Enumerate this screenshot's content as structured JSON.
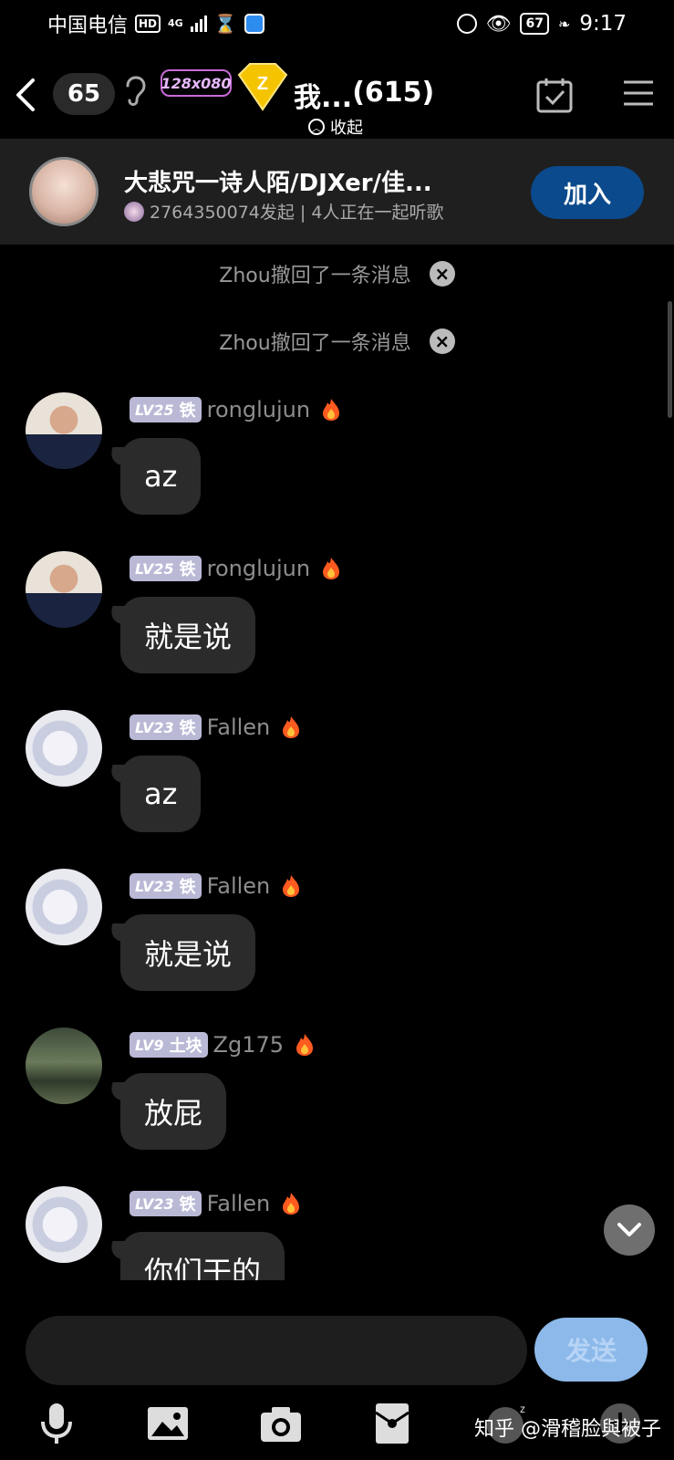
{
  "status_bar": {
    "carrier": "中国电信",
    "hd": "HD",
    "net": "4G",
    "battery": "67",
    "time": "9:17"
  },
  "header": {
    "member_count": "65",
    "club_badge": "128x080",
    "title": "我...",
    "title_count": "(615)",
    "collapse_label": "收起"
  },
  "listen_banner": {
    "title": "大悲咒一诗人陌/DJXer/佳...",
    "subtitle": "2764350074发起 | 4人正在一起听歌",
    "join_label": "加入"
  },
  "recalls": [
    {
      "text": "Zhou撤回了一条消息"
    },
    {
      "text": "Zhou撤回了一条消息"
    }
  ],
  "messages": [
    {
      "level": "LV25",
      "tier": "铁",
      "user": "ronglujun",
      "text": "az"
    },
    {
      "level": "LV25",
      "tier": "铁",
      "user": "ronglujun",
      "text": "就是说"
    },
    {
      "level": "LV23",
      "tier": "铁",
      "user": "Fallen",
      "text": "az"
    },
    {
      "level": "LV23",
      "tier": "铁",
      "user": "Fallen",
      "text": "就是说"
    },
    {
      "level": "LV9",
      "tier": "土块",
      "user": "Zg175",
      "text": "放屁"
    },
    {
      "level": "LV23",
      "tier": "铁",
      "user": "Fallen",
      "text": "你们干的"
    }
  ],
  "composer": {
    "value": "",
    "send_label": "发送"
  },
  "toolbar": [
    "mic-icon",
    "image-icon",
    "camera-icon",
    "red-packet-icon",
    "emoji-icon",
    "plus-icon"
  ],
  "watermark": "知乎 @滑稽脸與被子"
}
